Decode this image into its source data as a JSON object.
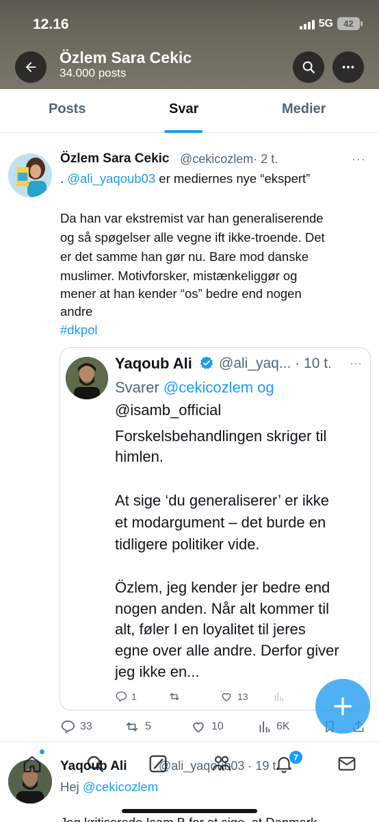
{
  "status_bar": {
    "time": "12.16",
    "network": "5G",
    "battery": "42"
  },
  "header": {
    "name": "Özlem Sara Cekic",
    "post_count": "34.000 posts"
  },
  "tabs": [
    {
      "label": "Posts"
    },
    {
      "label": "Svar"
    },
    {
      "label": "Medier"
    }
  ],
  "tweet": {
    "name": "Özlem Sara Cekic",
    "handle": "@cekicozlem",
    "time": "· 2 t.",
    "lines": [
      {
        "prefix": ". ",
        "mention": "@ali_yaqoub03",
        "rest": " er mediernes nye “ekspert”"
      },
      {
        "text": "Da han var ekstremist var han generaliserende"
      },
      {
        "text": "og så spøgelser alle vegne ift ikke-troende. Det"
      },
      {
        "text": "er det samme han gør nu. Bare mod danske"
      },
      {
        "text": "muslimer. Motivforsker, mistænkeliggør og"
      },
      {
        "text": "mener at han kender “os” bedre end nogen"
      },
      {
        "text": "andre"
      }
    ],
    "hashtag": "#dkpol",
    "stats": {
      "replies": "33",
      "reposts": "5",
      "likes": "10",
      "views": "6K"
    }
  },
  "quote": {
    "name": "Yaqoub Ali",
    "handle": "@ali_yaq...",
    "time": "· 10 t.",
    "reply_prefix": "Svarer ",
    "reply_mention_1": "@cekicozlem",
    "reply_joiner": " og",
    "reply_mention_2": "@isamb_official",
    "lines": [
      "Forskelsbehandlingen skriger til",
      "himlen.",
      "At sige ‘du generaliserer’ er ikke",
      "et modargument – det burde en",
      "tidligere politiker vide.",
      "Özlem, jeg kender jer bedre end",
      "nogen anden. Når alt kommer til",
      "alt, føler I en loyalitet til jeres",
      "egne over alle andre. Derfor giver",
      "jeg ikke en..."
    ],
    "stats": {
      "replies": "1",
      "likes": "13"
    }
  },
  "next_tweet": {
    "name": "Yaqoub Ali",
    "handle": "@ali_yaqoub03",
    "time": "· 19 t.",
    "line1_prefix": "Hej ",
    "line1_mention": "@cekicozlem",
    "line2": "Jeg kritiserede Isam B for at sige, at Danmark"
  },
  "bottom_nav": {
    "notifications_badge": "7"
  },
  "colors": {
    "accent": "#1d9bf0",
    "text": "#0f1419",
    "muted": "#536471"
  }
}
